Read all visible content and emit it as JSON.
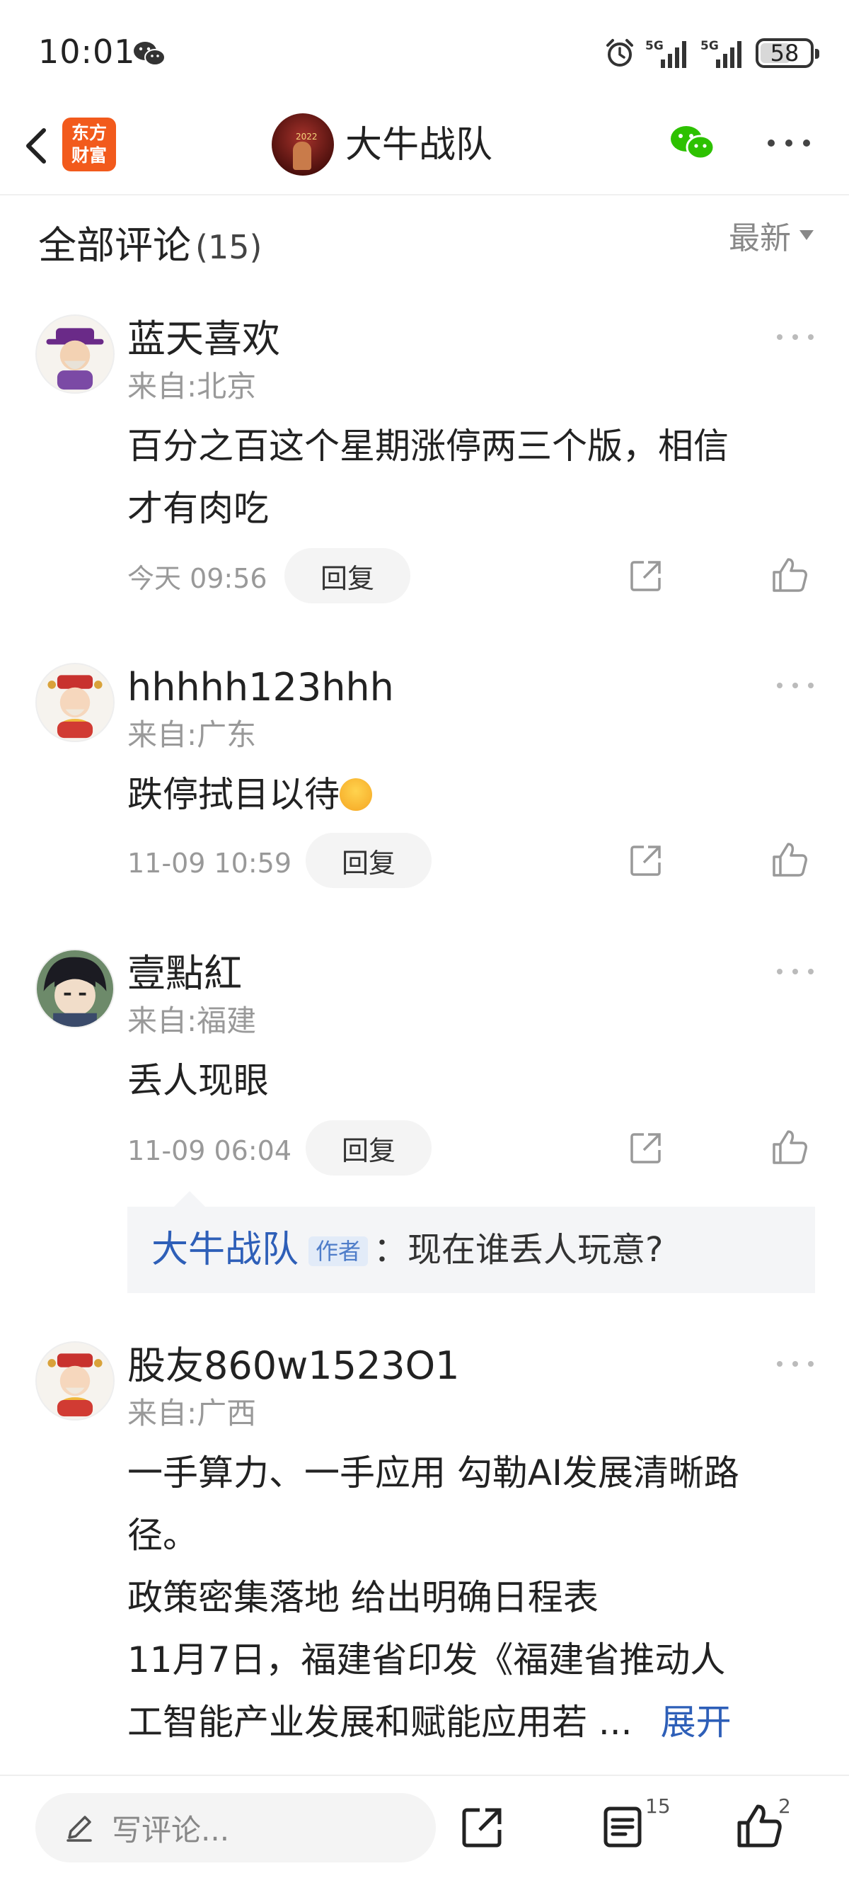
{
  "status_bar": {
    "time": "10:01",
    "network_1": "5G",
    "network_2": "5G",
    "battery": "58"
  },
  "nav": {
    "app_logo_line1": "东方",
    "app_logo_line2": "财富",
    "title": "大牛战队",
    "avatar_tag": "2022"
  },
  "comments_header": {
    "title": "全部评论",
    "count": "(15)",
    "sort": "最新"
  },
  "comments": [
    {
      "user": "蓝天喜欢",
      "location": "来自:北京",
      "body_line1": "百分之百这个星期涨停两三个版，相信",
      "body_line2": "才有肉吃",
      "time": "今天 09:56",
      "reply_label": "回复"
    },
    {
      "user": "hhhhh123hhh",
      "location": "来自:广东",
      "body_line1": "跌停拭目以待",
      "time": "11-09 10:59",
      "reply_label": "回复"
    },
    {
      "user": "壹點紅",
      "location": "来自:福建",
      "body_line1": "丢人现眼",
      "time": "11-09 06:04",
      "reply_label": "回复"
    },
    {
      "user": "股友860w1523O1",
      "location": "来自:广西",
      "body_line1": "一手算力、一手应用 勾勒AI发展清晰路",
      "body_line2": "径。",
      "body_line3": "政策密集落地 给出明确日程表",
      "body_line4": "11月7日，福建省印发《福建省推动人",
      "body_line5": "工智能产业发展和赋能应用若 ...",
      "expand_label": "展开"
    }
  ],
  "author_reply": {
    "name": "大牛战队",
    "badge": "作者",
    "text": "：现在谁丢人玩意?"
  },
  "bottom_bar": {
    "input_placeholder": "写评论...",
    "comment_count": "15",
    "like_count": "2"
  },
  "colors": {
    "link_blue": "#2e5fb8",
    "brand_orange": "#f25a1c",
    "wechat_green": "#2dc100"
  }
}
